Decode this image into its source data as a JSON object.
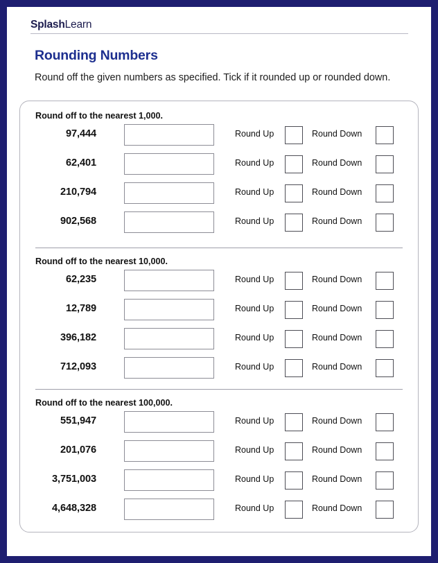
{
  "brand": {
    "logo_bold": "Splash",
    "logo_light": "Learn"
  },
  "worksheet": {
    "title": "Rounding Numbers",
    "instructions": "Round off the given numbers as specified. Tick if it rounded up or rounded down."
  },
  "labels": {
    "round_up": "Round Up",
    "round_down": "Round Down",
    "answer_placeholder": ""
  },
  "colors": {
    "page_border": "#1e1e70",
    "title_blue": "#1d2f8f",
    "logo_navy": "#1b1b4d",
    "card_border": "#b4b4bd",
    "input_border": "#8c8c95",
    "checkbox_border": "#4d4d55",
    "divider": "#9e9eaa"
  },
  "sections": [
    {
      "heading": "Round off to the nearest 1,000.",
      "rows": [
        {
          "number": "97,444",
          "answer": "",
          "up_checked": false,
          "down_checked": false
        },
        {
          "number": "62,401",
          "answer": "",
          "up_checked": false,
          "down_checked": false
        },
        {
          "number": "210,794",
          "answer": "",
          "up_checked": false,
          "down_checked": false
        },
        {
          "number": "902,568",
          "answer": "",
          "up_checked": false,
          "down_checked": false
        }
      ]
    },
    {
      "heading": "Round off to the nearest 10,000.",
      "rows": [
        {
          "number": "62,235",
          "answer": "",
          "up_checked": false,
          "down_checked": false
        },
        {
          "number": "12,789",
          "answer": "",
          "up_checked": false,
          "down_checked": false
        },
        {
          "number": "396,182",
          "answer": "",
          "up_checked": false,
          "down_checked": false
        },
        {
          "number": "712,093",
          "answer": "",
          "up_checked": false,
          "down_checked": false
        }
      ]
    },
    {
      "heading": "Round off to the nearest 100,000.",
      "rows": [
        {
          "number": "551,947",
          "answer": "",
          "up_checked": false,
          "down_checked": false
        },
        {
          "number": "201,076",
          "answer": "",
          "up_checked": false,
          "down_checked": false
        },
        {
          "number": "3,751,003",
          "answer": "",
          "up_checked": false,
          "down_checked": false
        },
        {
          "number": "4,648,328",
          "answer": "",
          "up_checked": false,
          "down_checked": false
        }
      ]
    }
  ]
}
